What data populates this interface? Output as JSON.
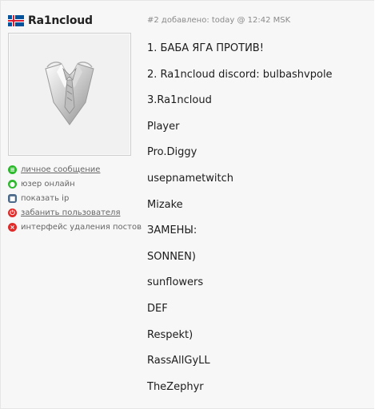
{
  "user": {
    "name": "Ra1ncloud"
  },
  "actions": [
    {
      "label": "личное сообщение",
      "icon": "message-icon",
      "color": "#2eb82e",
      "link": true
    },
    {
      "label": "юзер онлайн",
      "icon": "online-status-icon",
      "color": "#2eb82e",
      "link": false
    },
    {
      "label": "показать ip",
      "icon": "ip-monitor-icon",
      "color": "#4b6a8a",
      "link": false
    },
    {
      "label": "забанить пользователя",
      "icon": "ban-icon",
      "color": "#e02b2b",
      "link": true
    },
    {
      "label": "интерфейс удаления постов",
      "icon": "delete-icon",
      "color": "#e02b2b",
      "link": false
    }
  ],
  "post": {
    "meta": "#2 добавлено: today @ 12:42 MSK",
    "lines": [
      "1. БАБА ЯГА ПРОТИВ!",
      "2. Ra1ncloud discord: bulbashvpole",
      "3.Ra1ncloud",
      "Player",
      "Pro.Diggy",
      "usepnametwitch",
      "Mizake",
      "ЗАМЕНЫ:",
      "SONNEN)",
      "sunflowers",
      "DEF",
      "Respekt)",
      "RassAllGyLL",
      "TheZephyr"
    ]
  }
}
